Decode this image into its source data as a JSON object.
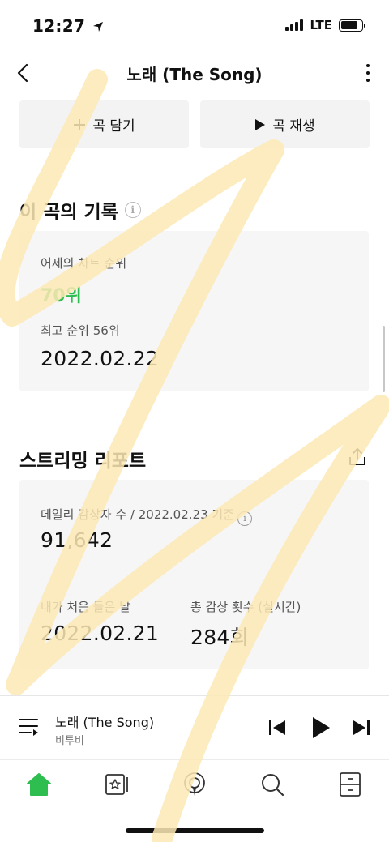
{
  "status_bar": {
    "time": "12:27",
    "network": "LTE"
  },
  "nav": {
    "title": "노래 (The Song)"
  },
  "actions": {
    "add_label": "곡 담기",
    "play_label": "곡 재생"
  },
  "record": {
    "title": "이 곡의 기록",
    "yesterday_label": "어제의 차트 순위",
    "yesterday_value": "70위",
    "peak_label": "최고 순위 56위",
    "peak_date": "2022.02.22"
  },
  "report": {
    "title": "스트리밍 리포트",
    "daily_label": "데일리 감상자 수 / 2022.02.23 기준",
    "daily_value": "91,642",
    "first_listen_label": "내가 처음 들은 날",
    "first_listen_value": "2022.02.21",
    "total_plays_label": "총 감상 횟수 (실시간)",
    "total_plays_value": "284회"
  },
  "mini_player": {
    "title": "노래 (The Song)",
    "artist": "비투비"
  },
  "colors": {
    "accent_green": "#2ebd4f",
    "card_bg": "#f6f6f6",
    "scribble": "#fde9b4"
  },
  "icons": {
    "back": "chevron-left-icon",
    "more": "more-vertical-icon",
    "add": "plus-icon",
    "play": "play-icon",
    "info": "info-icon",
    "share": "share-icon",
    "playlist": "playlist-icon",
    "prev": "skip-previous-icon",
    "next": "skip-next-icon",
    "tabs": [
      "home-icon",
      "library-icon",
      "podcast-icon",
      "search-icon",
      "storage-icon"
    ]
  }
}
